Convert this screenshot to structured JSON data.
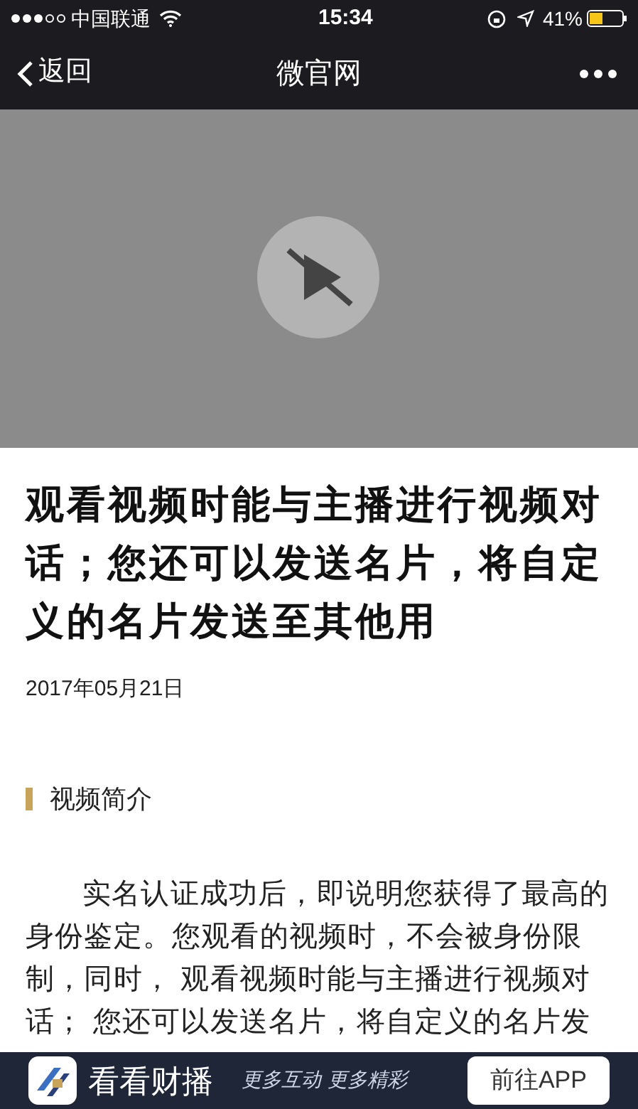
{
  "status_bar": {
    "carrier": "中国联通",
    "time": "15:34",
    "battery": "41%"
  },
  "nav_bar": {
    "back": "返回",
    "title": "微官网"
  },
  "article": {
    "title": "观看视频时能与主播进行视频对话；您还可以发送名片，将自定义的名片发送至其他用",
    "date": "2017年05月21日",
    "section": "视频简介",
    "paragraph": "实名认证成功后，即说明您获得了最高的身份鉴定。您观看的视频时，不会被身份限制，同时， 观看视频时能与主播进行视频对话； 您还可以发送名片，将自定义的名片发"
  },
  "app_banner": {
    "name": "看看财播",
    "slogan": "更多互动 更多精彩",
    "button": "前往APP"
  }
}
